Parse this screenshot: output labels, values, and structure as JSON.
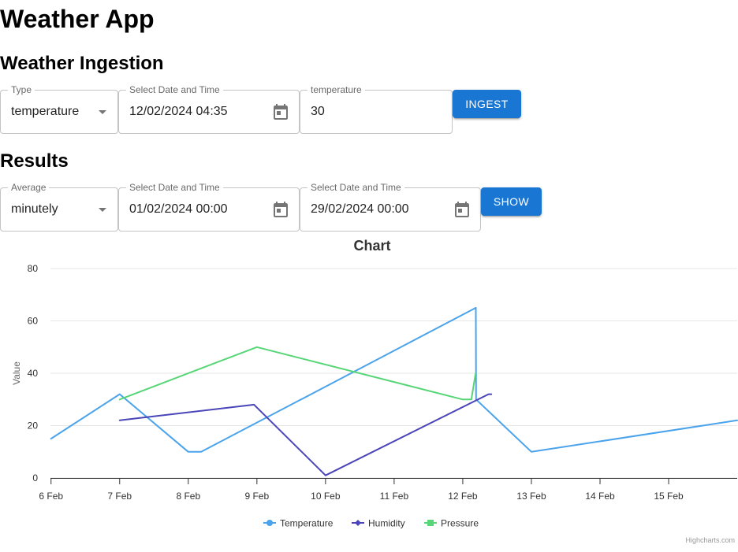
{
  "app_title": "Weather App",
  "ingestion": {
    "heading": "Weather Ingestion",
    "type_label": "Type",
    "type_value": "temperature",
    "datetime_label": "Select Date and Time",
    "datetime_value": "12/02/2024 04:35",
    "value_label": "temperature",
    "value_value": "30",
    "button_label": "Ingest"
  },
  "results": {
    "heading": "Results",
    "average_label": "Average",
    "average_value": "minutely",
    "start_label": "Select Date and Time",
    "start_value": "01/02/2024 00:00",
    "end_label": "Select Date and Time",
    "end_value": "29/02/2024 00:00",
    "button_label": "Show"
  },
  "credits": "Highcharts.com",
  "chart_data": {
    "type": "line",
    "title": "Chart",
    "ylabel": "Value",
    "xlabel": "",
    "ylim": [
      0,
      80
    ],
    "yticks": [
      0,
      20,
      40,
      60,
      80
    ],
    "xlim": [
      "2024-02-05 23:48",
      "2024-02-15 23:59"
    ],
    "xticks": [
      "6 Feb",
      "7 Feb",
      "8 Feb",
      "9 Feb",
      "10 Feb",
      "11 Feb",
      "12 Feb",
      "13 Feb",
      "14 Feb",
      "15 Feb"
    ],
    "grid": true,
    "legend": "bottom-center",
    "series": [
      {
        "name": "Temperature",
        "color": "#4aa3eb",
        "marker": "circle",
        "points": [
          [
            "2024-02-06 00:00",
            15
          ],
          [
            "2024-02-07 00:00",
            32
          ],
          [
            "2024-02-08 00:00",
            10
          ],
          [
            "2024-02-08 04:30",
            10
          ],
          [
            "2024-02-12 04:35",
            65
          ],
          [
            "2024-02-12 04:40",
            30
          ],
          [
            "2024-02-13 00:00",
            10
          ],
          [
            "2024-02-15 23:59",
            22
          ]
        ]
      },
      {
        "name": "Humidity",
        "color": "#4a45b8",
        "marker": "diamond",
        "points": [
          [
            "2024-02-07 00:00",
            22
          ],
          [
            "2024-02-08 23:00",
            28
          ],
          [
            "2024-02-10 00:00",
            1
          ],
          [
            "2024-02-12 09:00",
            32
          ],
          [
            "2024-02-12 10:00",
            32
          ]
        ]
      },
      {
        "name": "Pressure",
        "color": "#56d676",
        "marker": "square",
        "points": [
          [
            "2024-02-07 00:00",
            30
          ],
          [
            "2024-02-09 00:00",
            50
          ],
          [
            "2024-02-12 00:00",
            30
          ],
          [
            "2024-02-12 03:00",
            30
          ],
          [
            "2024-02-12 04:30",
            40
          ]
        ]
      }
    ]
  }
}
